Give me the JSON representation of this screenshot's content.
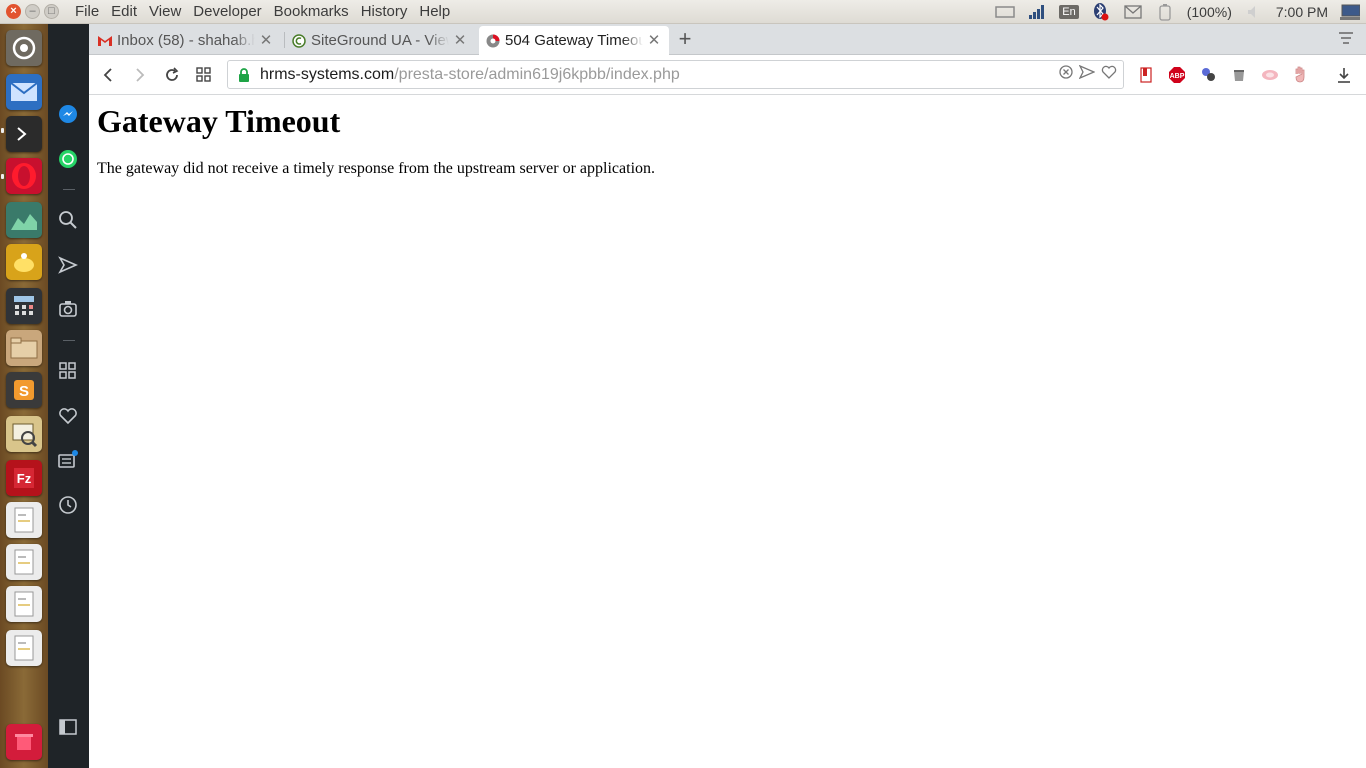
{
  "menubar": {
    "menus": [
      "File",
      "Edit",
      "View",
      "Developer",
      "Bookmarks",
      "History",
      "Help"
    ],
    "language": "En",
    "battery": "(100%)",
    "clock": "7:00 PM"
  },
  "tabs": [
    {
      "title": "Inbox (58) - shahab.h",
      "favicon": "gmail-icon"
    },
    {
      "title": "SiteGround UA - View",
      "favicon": "siteground-icon"
    },
    {
      "title": "504 Gateway Timeout",
      "favicon": "opera-page-icon",
      "active": true
    }
  ],
  "address": {
    "host": "hrms-systems.com",
    "path": "/presta-store/admin619j6kpbb/index.php"
  },
  "page": {
    "heading": "Gateway Timeout",
    "message": "The gateway did not receive a timely response from the upstream server or application."
  },
  "colors": {
    "sidebar": "#1f2428",
    "launcher": "#7a5a2d",
    "accent_close": "#e2532f"
  }
}
